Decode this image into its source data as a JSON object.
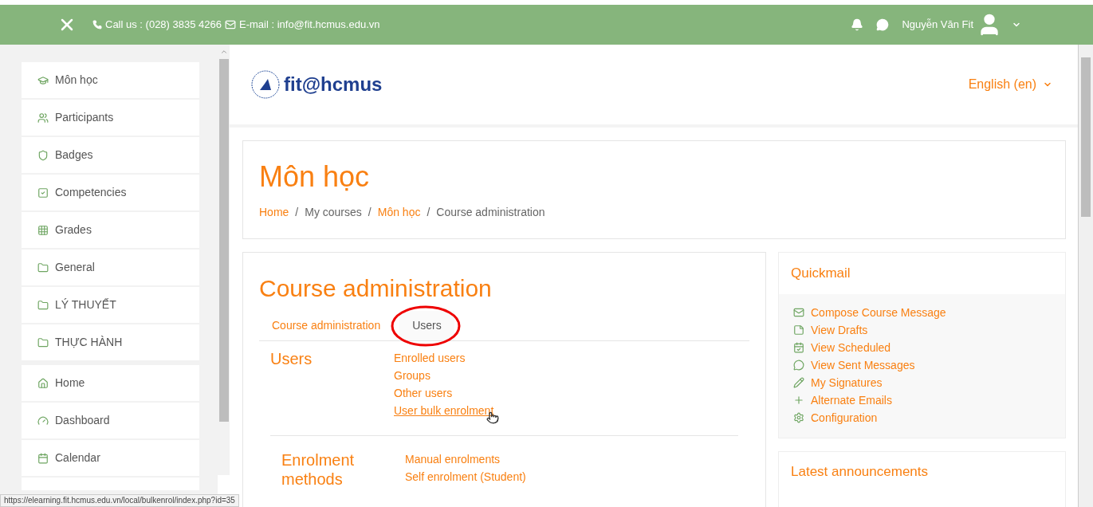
{
  "top_bar": {
    "phone": "Call us : (028) 3835 4266",
    "email": "E-mail : info@fit.hcmus.edu.vn",
    "user_name": "Nguyễn Văn Fit"
  },
  "sidebar": {
    "groups": [
      {
        "items": [
          {
            "label": "Môn học"
          },
          {
            "label": "Participants"
          },
          {
            "label": "Badges"
          },
          {
            "label": "Competencies"
          },
          {
            "label": "Grades"
          },
          {
            "label": "General"
          },
          {
            "label": "LÝ THUYẾT"
          },
          {
            "label": "THỰC HÀNH"
          }
        ]
      },
      {
        "items": [
          {
            "label": "Home"
          },
          {
            "label": "Dashboard"
          },
          {
            "label": "Calendar"
          }
        ]
      }
    ]
  },
  "header": {
    "logo_text": "fit@hcmus",
    "language": "English (en)"
  },
  "page_header": {
    "title": "Môn học",
    "breadcrumb": [
      {
        "kind": "item",
        "label": "Home",
        "link": true
      },
      {
        "kind": "separator",
        "label": "/"
      },
      {
        "kind": "item",
        "label": "My courses",
        "link": false
      },
      {
        "kind": "separator",
        "label": "/"
      },
      {
        "kind": "item",
        "label": "Môn học",
        "link": true
      },
      {
        "kind": "separator",
        "label": "/"
      },
      {
        "kind": "item",
        "label": "Course administration",
        "link": false
      }
    ]
  },
  "admin": {
    "title": "Course administration",
    "tabs": [
      {
        "label": "Course administration",
        "selected": false
      },
      {
        "label": "Users",
        "selected": true
      }
    ],
    "sections": [
      {
        "heading": "Users",
        "links": [
          {
            "label": "Enrolled users",
            "underlined": false
          },
          {
            "label": "Groups",
            "underlined": false
          },
          {
            "label": "Other users",
            "underlined": false
          },
          {
            "label": "User bulk enrolment",
            "underlined": true
          }
        ]
      },
      {
        "heading": "Enrolment methods",
        "links": [
          {
            "label": "Manual enrolments",
            "underlined": false
          },
          {
            "label": "Self enrolment (Student)",
            "underlined": false
          }
        ]
      }
    ]
  },
  "quickmail": {
    "title": "Quickmail",
    "items": [
      {
        "label": "Compose Course Message"
      },
      {
        "label": "View Drafts"
      },
      {
        "label": "View Scheduled"
      },
      {
        "label": "View Sent Messages"
      },
      {
        "label": "My Signatures"
      },
      {
        "label": "Alternate Emails"
      },
      {
        "label": "Configuration"
      }
    ]
  },
  "announcements": {
    "title": "Latest announcements"
  },
  "status_bar": {
    "url": "https://elearning.fit.hcmus.edu.vn/local/bulkenrol/index.php?id=35"
  }
}
